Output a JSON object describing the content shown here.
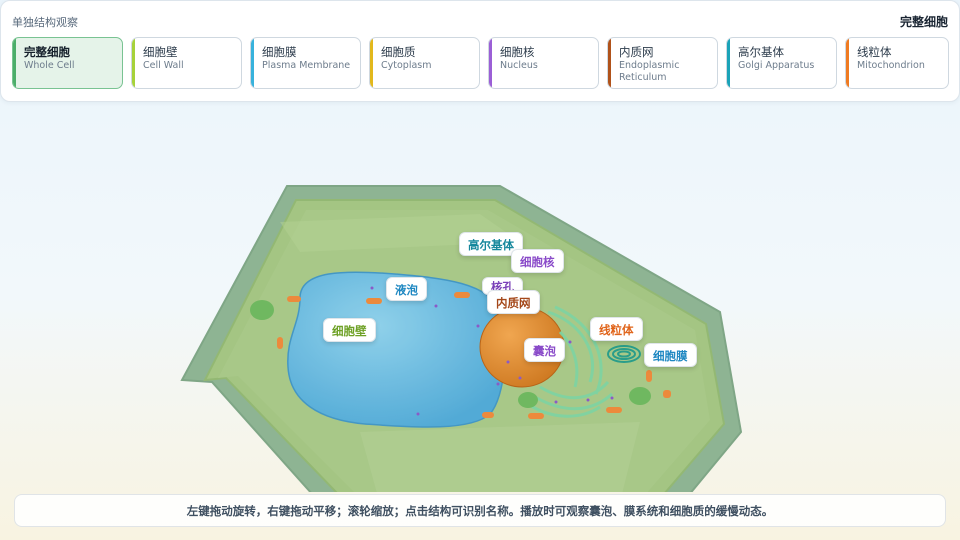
{
  "header": {
    "panel_title": "单独结构观察",
    "current_structure": "完整细胞"
  },
  "tabs": [
    {
      "cn": "完整细胞",
      "en": "Whole Cell",
      "accent": "#4cae6a",
      "active": true
    },
    {
      "cn": "细胞壁",
      "en": "Cell Wall",
      "accent": "#a6d23a",
      "active": false
    },
    {
      "cn": "细胞膜",
      "en": "Plasma Membrane",
      "accent": "#38b2dc",
      "active": false
    },
    {
      "cn": "细胞质",
      "en": "Cytoplasm",
      "accent": "#e2b81c",
      "active": false
    },
    {
      "cn": "细胞核",
      "en": "Nucleus",
      "accent": "#9b5fd6",
      "active": false
    },
    {
      "cn": "内质网",
      "en": "Endoplasmic Reticulum",
      "accent": "#b0521a",
      "active": false
    },
    {
      "cn": "高尔基体",
      "en": "Golgi Apparatus",
      "accent": "#1aa3b8",
      "active": false
    },
    {
      "cn": "线粒体",
      "en": "Mitochondrion",
      "accent": "#ef7b22",
      "active": false
    }
  ],
  "scene_labels": {
    "golgi": {
      "text": "高尔基体",
      "color": "#15879c"
    },
    "nucleus": {
      "text": "细胞核",
      "color": "#8a4bc9"
    },
    "pore": {
      "text": "核孔",
      "color": "#7a3fb8"
    },
    "er": {
      "text": "内质网",
      "color": "#a4481a"
    },
    "vacuole": {
      "text": "液泡",
      "color": "#1f88c2"
    },
    "wall": {
      "text": "细胞壁",
      "color": "#6ea126"
    },
    "mito": {
      "text": "线粒体",
      "color": "#e0641a"
    },
    "vesicle": {
      "text": "囊泡",
      "color": "#8a4bc9"
    },
    "membrane": {
      "text": "细胞膜",
      "color": "#1f88c2"
    }
  },
  "hint": "左键拖动旋转，右键拖动平移；滚轮缩放；点击结构可识别名称。播放时可观察囊泡、膜系统和细胞质的缓慢动态。"
}
